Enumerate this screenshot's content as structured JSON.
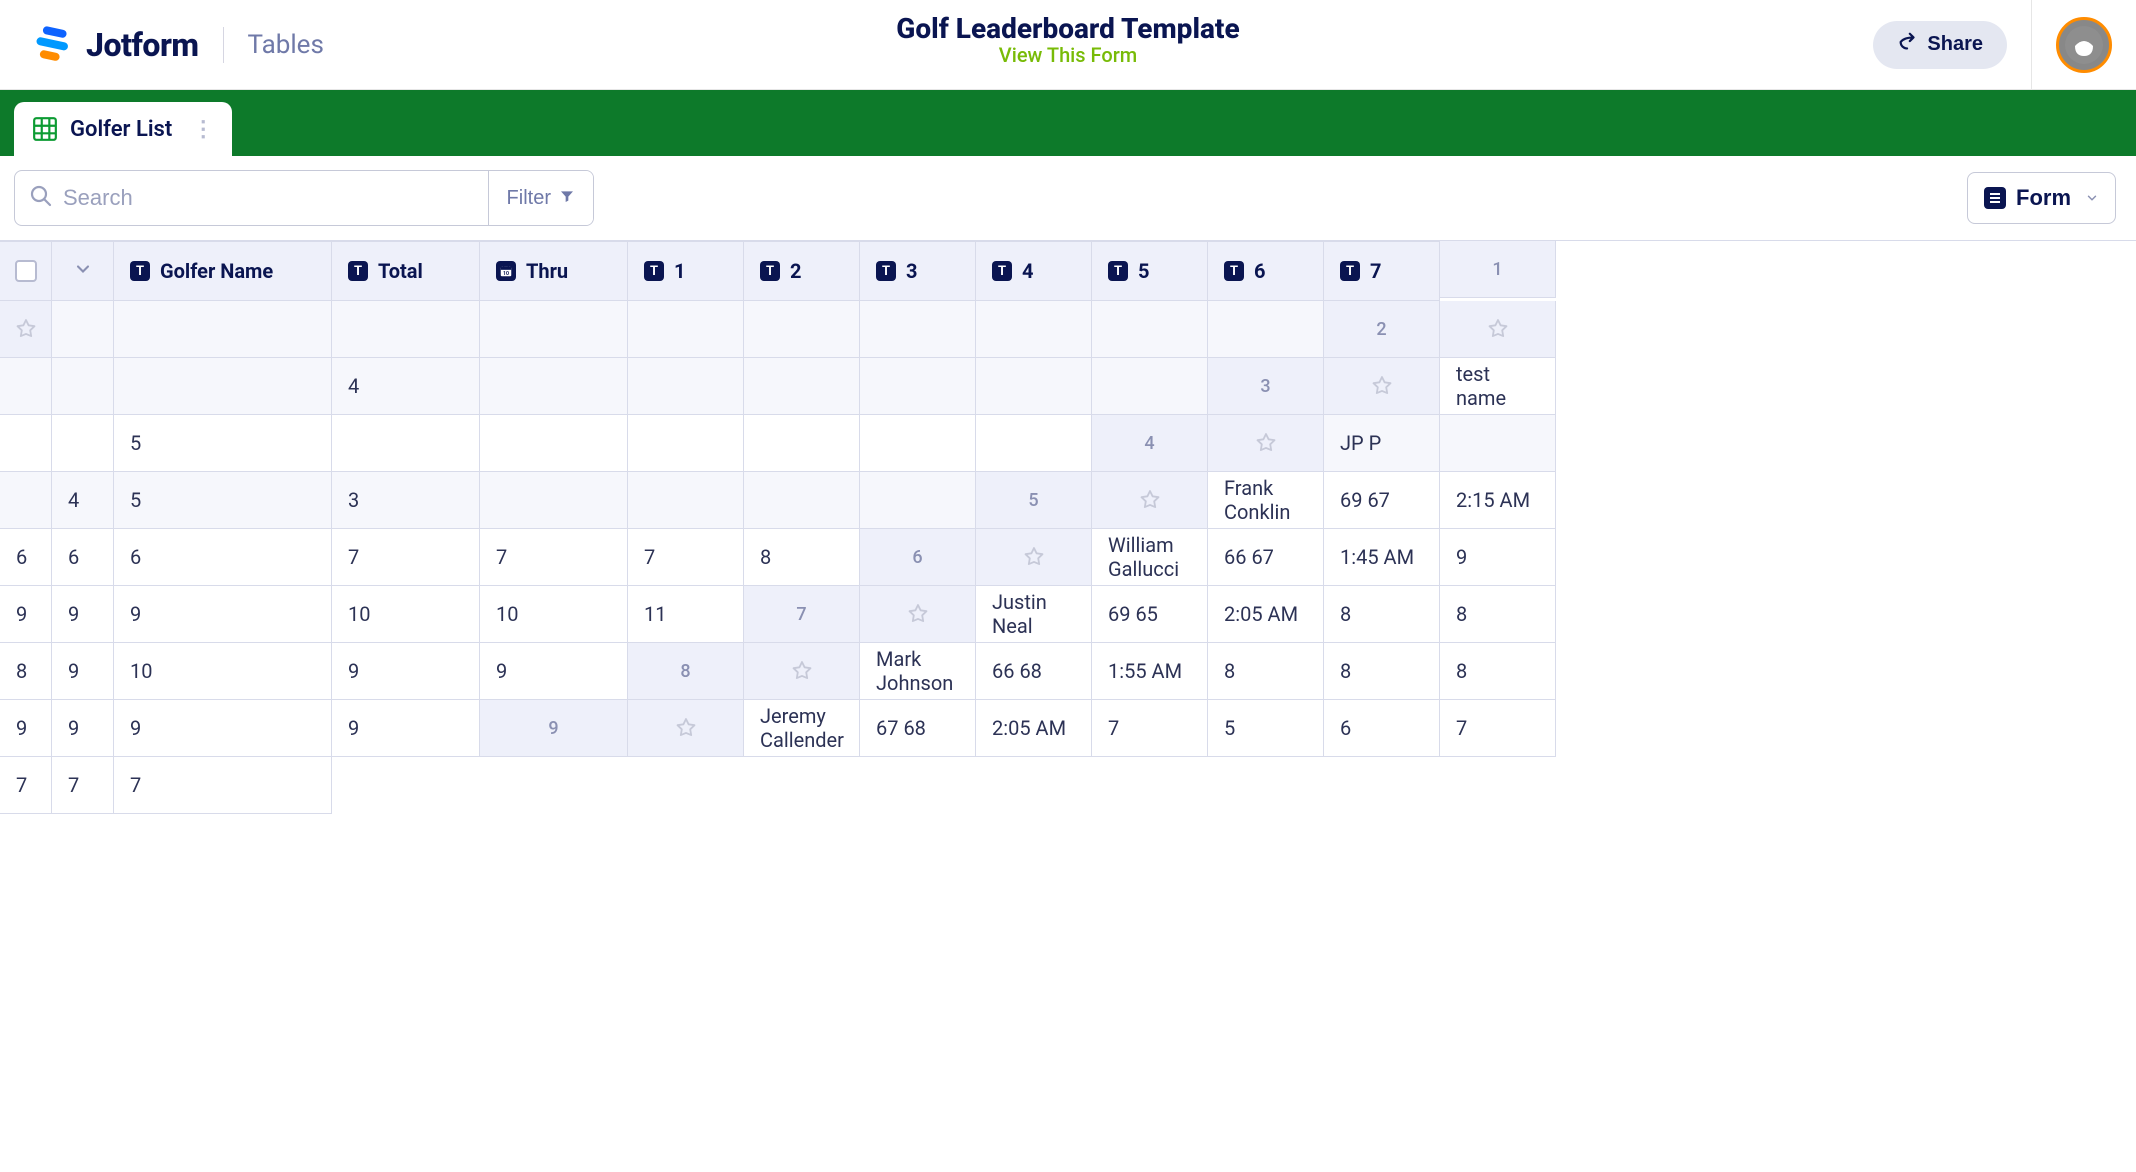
{
  "header": {
    "brand": "Jotform",
    "product": "Tables",
    "title": "Golf Leaderboard Template",
    "view_link": "View This Form",
    "share_label": "Share"
  },
  "tabs": {
    "active": "Golfer List"
  },
  "toolbar": {
    "search_placeholder": "Search",
    "filter_label": "Filter",
    "form_label": "Form"
  },
  "columns": [
    {
      "label": "Golfer Name",
      "icon": "T"
    },
    {
      "label": "Total",
      "icon": "T"
    },
    {
      "label": "Thru",
      "icon": "cal"
    },
    {
      "label": "1",
      "icon": "T"
    },
    {
      "label": "2",
      "icon": "T"
    },
    {
      "label": "3",
      "icon": "T"
    },
    {
      "label": "4",
      "icon": "T"
    },
    {
      "label": "5",
      "icon": "T"
    },
    {
      "label": "6",
      "icon": "T"
    },
    {
      "label": "7",
      "icon": "T"
    }
  ],
  "rows": [
    {
      "n": "1",
      "shade": true,
      "name": "",
      "total": "",
      "thru": "",
      "h": [
        "",
        "",
        "",
        "",
        "",
        "",
        ""
      ]
    },
    {
      "n": "2",
      "shade": true,
      "name": "",
      "total": "",
      "thru": "",
      "h": [
        "4",
        "",
        "",
        "",
        "",
        "",
        ""
      ]
    },
    {
      "n": "3",
      "shade": false,
      "name": "test name",
      "total": "",
      "thru": "",
      "h": [
        "5",
        "",
        "",
        "",
        "",
        "",
        ""
      ]
    },
    {
      "n": "4",
      "shade": true,
      "name": "JP P",
      "total": "",
      "thru": "",
      "h": [
        "4",
        "5",
        "3",
        "",
        "",
        "",
        ""
      ]
    },
    {
      "n": "5",
      "shade": false,
      "name": "Frank Conklin",
      "total": "69 67",
      "thru": "2:15 AM",
      "h": [
        "6",
        "6",
        "6",
        "7",
        "7",
        "7",
        "8"
      ]
    },
    {
      "n": "6",
      "shade": false,
      "name": "William Gallucci",
      "total": "66 67",
      "thru": "1:45 AM",
      "h": [
        "9",
        "9",
        "9",
        "9",
        "10",
        "10",
        "11"
      ]
    },
    {
      "n": "7",
      "shade": false,
      "name": "Justin Neal",
      "total": "69 65",
      "thru": "2:05 AM",
      "h": [
        "8",
        "8",
        "8",
        "9",
        "10",
        "9",
        "9"
      ]
    },
    {
      "n": "8",
      "shade": false,
      "name": "Mark Johnson",
      "total": "66 68",
      "thru": "1:55 AM",
      "h": [
        "8",
        "8",
        "8",
        "9",
        "9",
        "9",
        "9"
      ]
    },
    {
      "n": "9",
      "shade": false,
      "name": "Jeremy Callender",
      "total": "67 68",
      "thru": "2:05 AM",
      "h": [
        "7",
        "5",
        "6",
        "7",
        "7",
        "7",
        "7"
      ]
    }
  ]
}
